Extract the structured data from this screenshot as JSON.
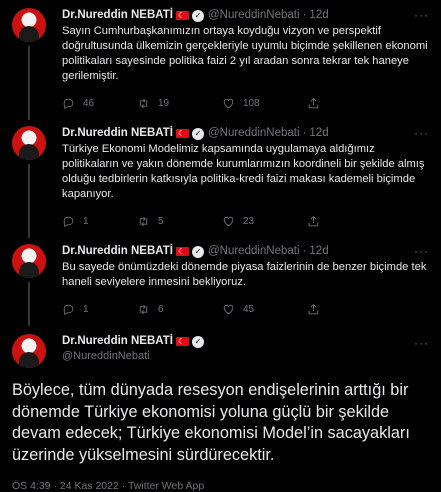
{
  "tweets": [
    {
      "name": "Dr.Nureddin NEBATİ",
      "handle": "@NureddinNebati",
      "time": "12d",
      "text": "Sayın Cumhurbaşkanımızın ortaya koyduğu vizyon ve perspektif doğrultusunda ülkemizin gerçekleriyle uyumlu biçimde şekillenen ekonomi politikaları sayesinde politika faizi 2 yıl aradan sonra tekrar tek haneye gerilemiştir.",
      "replies": "46",
      "retweets": "19",
      "likes": "108"
    },
    {
      "name": "Dr.Nureddin NEBATİ",
      "handle": "@NureddinNebati",
      "time": "12d",
      "text": "Türkiye Ekonomi Modelimiz kapsamında uygulamaya aldığımız politikaların ve yakın dönemde kurumlarımızın koordineli bir şekilde almış olduğu tedbirlerin katkısıyla politika-kredi faizi makası kademeli biçimde kapanıyor.",
      "replies": "1",
      "retweets": "5",
      "likes": "23"
    },
    {
      "name": "Dr.Nureddin NEBATİ",
      "handle": "@NureddinNebati",
      "time": "12d",
      "text": "Bu sayede önümüzdeki dönemde piyasa faizlerinin de benzer biçimde tek haneli seviyelere inmesini bekliyoruz.",
      "replies": "1",
      "retweets": "6",
      "likes": "45"
    }
  ],
  "main": {
    "name": "Dr.Nureddin NEBATİ",
    "handle": "@NureddinNebati",
    "text": "Böylece, tüm dünyada resesyon endişelerinin arttığı bir dönemde Türkiye ekonomisi yoluna güçlü bir şekilde devam edecek; Türkiye ekonomisi Model’in sacayakları üzerinde yükselmesini sürdürecektir.",
    "meta": "ÖS 4:39 · 24 Kas 2022 · Twitter Web App"
  },
  "icons": {
    "more": "more-icon",
    "reply": "reply-icon",
    "retweet": "retweet-icon",
    "like": "heart-icon",
    "share": "share-icon"
  }
}
